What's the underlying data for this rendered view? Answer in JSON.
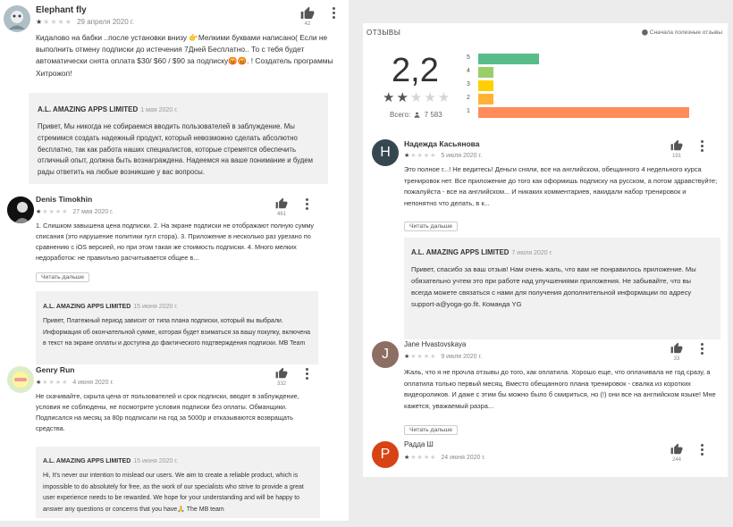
{
  "left": {
    "r1": {
      "author": "Elephant fly",
      "date": "29 апреля 2020 г.",
      "likes": "42",
      "text": "Кидалово на бабки ..после установки внизу 👉Мелкими буквами написано( Если не выполнить отмену подписки до истечения 7Дней Бесплатно.. То с тебя будет автоматически снята оплата $30/ $60 / $90 за подписку😡😡. ! Создатель программы Хитрожоп!",
      "reply_name": "A.L. AMAZING APPS LIMITED",
      "reply_date": "1 мая 2020 г.",
      "reply_text": "Привет, Мы никогда не собираемся вводить пользователей в заблуждение. Мы стремимся создать надежный продукт, который невозможно сделать абсолютно бесплатно, так как работа наших специалистов, которые стремятся обеспечить отличный опыт, должна быть вознаграждена. Надеемся на ваше понимание и будем рады ответить на любые возникшие у вас вопросы."
    },
    "r2": {
      "author": "Denis Timokhin",
      "date": "27 мая 2020 г.",
      "likes": "461",
      "text": "1. Слишком завышена цена подписки. 2. На экране подписки не отображают полную сумму списания (это нарушение политики гугл стора). 3. Приложение в несколько раз урезано по сравнению с iOS версией, но при этом такая же стоимость подписки. 4. Много мелких недоработок: не правильно расчитывается общее в...",
      "read_more": "Читать дальше",
      "reply_name": "A.L. AMAZING APPS LIMITED",
      "reply_date": "15 июня 2020 г.",
      "reply_text": "Привет, Платежный период зависит от типа плана подписки, который вы выбрали. Информация об окончательной сумме, которая будет взиматься за вашу покупку, включена в текст на экране оплаты и доступна до фактического подтверждения подписки. MB Team"
    },
    "r3": {
      "author": "Genry Run",
      "date": "4 июня 2020 г.",
      "likes": "332",
      "text": "Не скачивайте, скрыта цена от пользователей и срок подписки, вводят в заблуждение, условия не соблюдены, не посмотрите условия подписки без оплаты. Обманщики. Подписался на месяц за 80р подписали на год за 5000р и отказываются возвращать средства.",
      "reply_name": "A.L. AMAZING APPS LIMITED",
      "reply_date": "15 июня 2020 г.",
      "reply_text": "Hi, It's never our intention to mislead our users. We aim to create a reliable product, which is impossible to do absolutely for free, as the work of our specialists who strive to provide a great user experience needs to be rewarded. We hope for your understanding and will be happy to answer any questions or concerns that you have🙏 The MB team"
    }
  },
  "right": {
    "summary": {
      "title": "ОТЗЫВЫ",
      "sort": "⬤ Сначала полезные отзывы",
      "rating": "2,2",
      "rating_stars": 2,
      "total_label": "Всего:",
      "total_icon": "person-icon",
      "total": "7 583",
      "bars": [
        {
          "label": "5",
          "fraction": 0.29,
          "color": "#57bb8a"
        },
        {
          "label": "4",
          "fraction": 0.07,
          "color": "#9ace6a"
        },
        {
          "label": "3",
          "fraction": 0.07,
          "color": "#ffcf02"
        },
        {
          "label": "2",
          "fraction": 0.07,
          "color": "#ffb235"
        },
        {
          "label": "1",
          "fraction": 1.0,
          "color": "#ff8c5a"
        }
      ]
    },
    "r1": {
      "author": "Надежда Касьянова",
      "avatar_letter": "Н",
      "date": "5 июля 2020 г.",
      "likes": "191",
      "text": "Это полное г...! Не ведитесь! Деньги сняли, все на английском, обещанного 4 недельного курса тренировок нет. Все приложение до того как оформишь подписку на русском, а потом здравствуйте; пожалуйста - все на английском... И никаких комментариев, накидали набор тренировок и непонятно что делать, в к...",
      "read_more": "Читать дальше",
      "reply_name": "A.L. AMAZING APPS LIMITED",
      "reply_date": "7 июля 2020 г.",
      "reply_text": "Привет, спасибо за ваш отзыв! Нам очень жаль, что вам не понравилось приложение. Мы обязательно учтем это при работе над улучшениями приложения. Не забывайте, что вы всегда можете связаться с нами для получения дополнительной информации по адресу support-a@yoga-go.fit. Команда YG"
    },
    "r2": {
      "author": "Jane Hvastovskaya",
      "avatar_letter": "J",
      "date": "9 июля 2020 г.",
      "likes": "33",
      "text": "Жаль, что я не прочла отзывы до того, как оплатила. Хорошо еще, что оплачивала не год сразу, а оплатила только первый месяц. Вместо обещанного плана тренировок - свалка из коротких видеороликов. И даже с этим бы можно было б смириться, но (!) они все на английском языке! Мне кажется, уважаемый разра...",
      "read_more": "Читать дальше"
    },
    "r3": {
      "author": "Радда Ш",
      "avatar_letter": "P",
      "date": "24 июня 2020 г.",
      "likes": "244"
    }
  },
  "colors": {
    "avatar_n": "#37474f",
    "avatar_j": "#8d6e63",
    "avatar_p": "#d84315",
    "reply_bg": "#f1f1f1"
  }
}
